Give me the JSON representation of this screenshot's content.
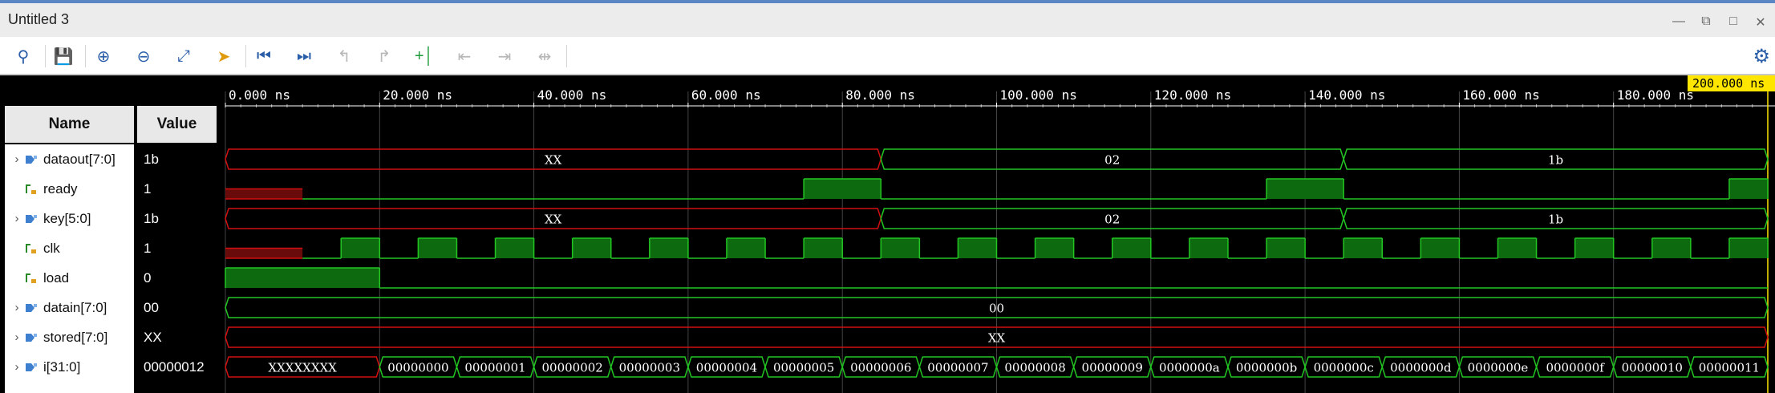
{
  "window": {
    "title": "Untitled 3"
  },
  "toolbar": {
    "icons": [
      "search-icon",
      "save-icon",
      "zoom-in-icon",
      "zoom-out-icon",
      "zoom-fit-icon",
      "go-to-cursor-icon",
      "go-to-start-icon",
      "go-to-end-icon",
      "previous-transition-icon",
      "next-transition-icon",
      "add-marker-icon",
      "previous-marker-icon",
      "next-marker-icon",
      "swap-cursors-icon",
      "settings-icon"
    ]
  },
  "headers": {
    "name": "Name",
    "value": "Value"
  },
  "cursor_time": "200.000 ns",
  "timescale": {
    "ticks": [
      "0.000 ns",
      "20.000 ns",
      "40.000 ns",
      "60.000 ns",
      "80.000 ns",
      "100.000 ns",
      "120.000 ns",
      "140.000 ns",
      "160.000 ns",
      "180.000 ns"
    ]
  },
  "signals": [
    {
      "name": "dataout[7:0]",
      "value": "1b",
      "type": "bus",
      "expandable": true,
      "segments": [
        {
          "t0": 0,
          "t1": 85,
          "label": "XX",
          "state": "x"
        },
        {
          "t0": 85,
          "t1": 145,
          "label": "02",
          "state": "v"
        },
        {
          "t0": 145,
          "t1": 200,
          "label": "1b",
          "state": "v"
        }
      ]
    },
    {
      "name": "ready",
      "value": "1",
      "type": "bit",
      "expandable": false,
      "segments": [
        {
          "t0": 0,
          "t1": 10,
          "state": "x"
        },
        {
          "t0": 10,
          "t1": 75,
          "state": "0"
        },
        {
          "t0": 75,
          "t1": 85,
          "state": "1"
        },
        {
          "t0": 85,
          "t1": 135,
          "state": "0"
        },
        {
          "t0": 135,
          "t1": 145,
          "state": "1"
        },
        {
          "t0": 145,
          "t1": 195,
          "state": "0"
        },
        {
          "t0": 195,
          "t1": 200,
          "state": "1"
        }
      ]
    },
    {
      "name": "key[5:0]",
      "value": "1b",
      "type": "bus",
      "expandable": true,
      "segments": [
        {
          "t0": 0,
          "t1": 85,
          "label": "XX",
          "state": "x"
        },
        {
          "t0": 85,
          "t1": 145,
          "label": "02",
          "state": "v"
        },
        {
          "t0": 145,
          "t1": 200,
          "label": "1b",
          "state": "v"
        }
      ]
    },
    {
      "name": "clk",
      "value": "1",
      "type": "clock",
      "expandable": false,
      "segments": [
        {
          "t0": 0,
          "t1": 10,
          "state": "x"
        }
      ],
      "clock": {
        "start": 10,
        "period": 10,
        "first_low": 5
      }
    },
    {
      "name": "load",
      "value": "0",
      "type": "bit",
      "expandable": false,
      "segments": [
        {
          "t0": 0,
          "t1": 20,
          "state": "1"
        },
        {
          "t0": 20,
          "t1": 200,
          "state": "0"
        }
      ]
    },
    {
      "name": "datain[7:0]",
      "value": "00",
      "type": "bus",
      "expandable": true,
      "segments": [
        {
          "t0": 0,
          "t1": 200,
          "label": "00",
          "state": "v"
        }
      ]
    },
    {
      "name": "stored[7:0]",
      "value": "XX",
      "type": "bus",
      "expandable": true,
      "segments": [
        {
          "t0": 0,
          "t1": 200,
          "label": "XX",
          "state": "x"
        }
      ]
    },
    {
      "name": "i[31:0]",
      "value": "00000012",
      "type": "bus",
      "expandable": true,
      "segments": [
        {
          "t0": 0,
          "t1": 20,
          "label": "XXXXXXXX",
          "state": "x"
        },
        {
          "t0": 20,
          "t1": 30,
          "label": "00000000",
          "state": "v"
        },
        {
          "t0": 30,
          "t1": 40,
          "label": "00000001",
          "state": "v"
        },
        {
          "t0": 40,
          "t1": 50,
          "label": "00000002",
          "state": "v"
        },
        {
          "t0": 50,
          "t1": 60,
          "label": "00000003",
          "state": "v"
        },
        {
          "t0": 60,
          "t1": 70,
          "label": "00000004",
          "state": "v"
        },
        {
          "t0": 70,
          "t1": 80,
          "label": "00000005",
          "state": "v"
        },
        {
          "t0": 80,
          "t1": 90,
          "label": "00000006",
          "state": "v"
        },
        {
          "t0": 90,
          "t1": 100,
          "label": "00000007",
          "state": "v"
        },
        {
          "t0": 100,
          "t1": 110,
          "label": "00000008",
          "state": "v"
        },
        {
          "t0": 110,
          "t1": 120,
          "label": "00000009",
          "state": "v"
        },
        {
          "t0": 120,
          "t1": 130,
          "label": "0000000a",
          "state": "v"
        },
        {
          "t0": 130,
          "t1": 140,
          "label": "0000000b",
          "state": "v"
        },
        {
          "t0": 140,
          "t1": 150,
          "label": "0000000c",
          "state": "v"
        },
        {
          "t0": 150,
          "t1": 160,
          "label": "0000000d",
          "state": "v"
        },
        {
          "t0": 160,
          "t1": 170,
          "label": "0000000e",
          "state": "v"
        },
        {
          "t0": 170,
          "t1": 180,
          "label": "0000000f",
          "state": "v"
        },
        {
          "t0": 180,
          "t1": 190,
          "label": "00000010",
          "state": "v"
        },
        {
          "t0": 190,
          "t1": 200,
          "label": "00000011",
          "state": "v"
        }
      ]
    }
  ],
  "colors": {
    "bus_valid": "#22c522",
    "bus_x": "#d01010",
    "bit_high_fill": "#0e6a0e",
    "x_fill": "#6a0b0b",
    "grid": "#444444",
    "cursor": "#ffe600"
  }
}
